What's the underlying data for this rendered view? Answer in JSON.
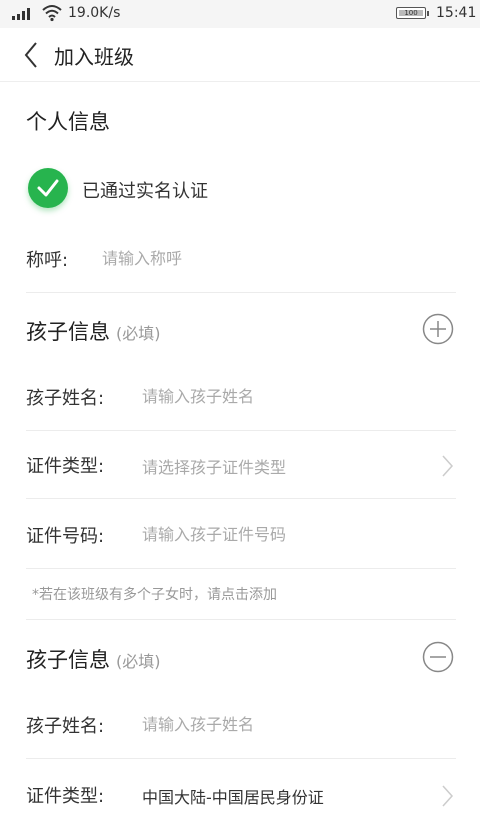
{
  "status_bar": {
    "network_speed": "19.0K/s",
    "battery_level": "100",
    "time": "15:41",
    "icons": [
      "signal-icon",
      "wifi-icon",
      "battery-icon"
    ]
  },
  "header": {
    "title": "加入班级",
    "back_icon": "chevron-left-icon"
  },
  "personal": {
    "section_title": "个人信息",
    "verified_text": "已通过实名认证",
    "salutation_label": "称呼:",
    "salutation_placeholder": "请输入称呼",
    "salutation_value": ""
  },
  "children": [
    {
      "section_title": "孩子信息",
      "required_note": "(必填)",
      "action_icon": "plus-circle-icon",
      "name_label": "孩子姓名:",
      "name_placeholder": "请输入孩子姓名",
      "id_type_label": "证件类型:",
      "id_type_placeholder": "请选择孩子证件类型",
      "id_type_value": "",
      "id_number_label": "证件号码:",
      "id_number_placeholder": "请输入孩子证件号码"
    },
    {
      "section_title": "孩子信息",
      "required_note": "(必填)",
      "action_icon": "minus-circle-icon",
      "name_label": "孩子姓名:",
      "name_placeholder": "请输入孩子姓名",
      "id_type_label": "证件类型:",
      "id_type_value": "中国大陆-中国居民身份证"
    }
  ],
  "hint_text": "*若在该班级有多个子女时，请点击添加",
  "colors": {
    "verified_green": "#27b44e",
    "placeholder_gray": "#aaaaaa",
    "divider": "#ececec"
  }
}
